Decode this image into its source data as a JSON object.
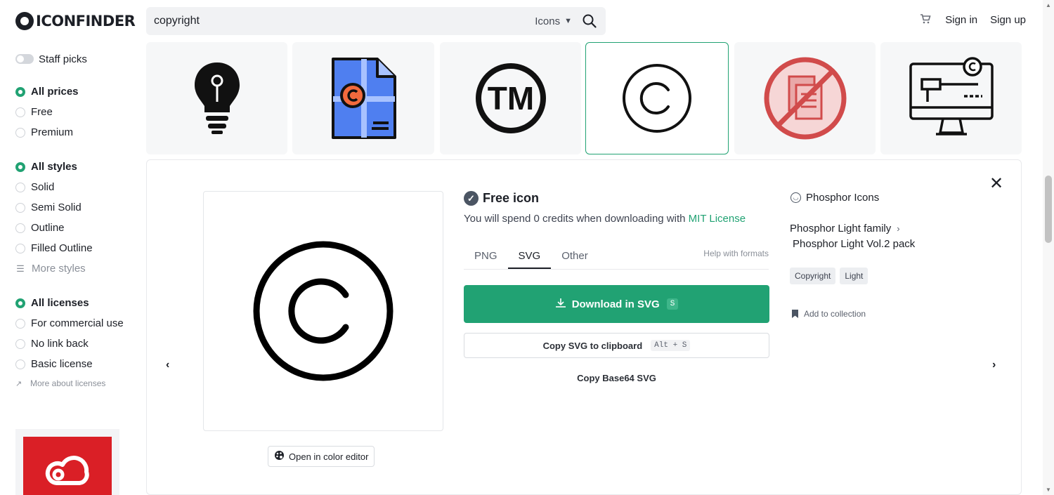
{
  "header": {
    "logo_text": "ICONFINDER",
    "search_value": "copyright",
    "search_type": "Icons",
    "sign_in": "Sign in",
    "sign_up": "Sign up"
  },
  "sidebar": {
    "staff_picks": "Staff picks",
    "prices": [
      "All prices",
      "Free",
      "Premium"
    ],
    "styles": [
      "All styles",
      "Solid",
      "Semi Solid",
      "Outline",
      "Filled Outline"
    ],
    "more_styles": "More styles",
    "licenses": [
      "All licenses",
      "For commercial use",
      "No link back",
      "Basic license"
    ],
    "more_licenses": "More about licenses"
  },
  "tiles": [
    {
      "icon": "lightbulb-icon"
    },
    {
      "icon": "document-copyright-icon"
    },
    {
      "icon": "trademark-icon"
    },
    {
      "icon": "copyright-icon",
      "selected": true
    },
    {
      "icon": "no-copy-icon"
    },
    {
      "icon": "computer-copyright-icon"
    }
  ],
  "detail": {
    "title": "Free icon",
    "credits_text": "You will spend 0 credits when downloading with",
    "license_link": "MIT License",
    "tabs": [
      "PNG",
      "SVG",
      "Other"
    ],
    "active_tab": "SVG",
    "help_formats": "Help with formats",
    "download_label": "Download in SVG",
    "download_shortcut": "S",
    "copy_label": "Copy SVG to clipboard",
    "copy_shortcut": "Alt + S",
    "copy_base64": "Copy Base64 SVG",
    "color_editor": "Open in color editor",
    "author": "Phosphor Icons",
    "family": "Phosphor Light family",
    "pack": "Phosphor Light Vol.2 pack",
    "tags": [
      "Copyright",
      "Light"
    ],
    "add_collection": "Add to collection"
  },
  "colors": {
    "accent": "#21a273",
    "text": "#1c1f26",
    "muted": "#8a8f98",
    "ad_red": "#da1f26"
  }
}
